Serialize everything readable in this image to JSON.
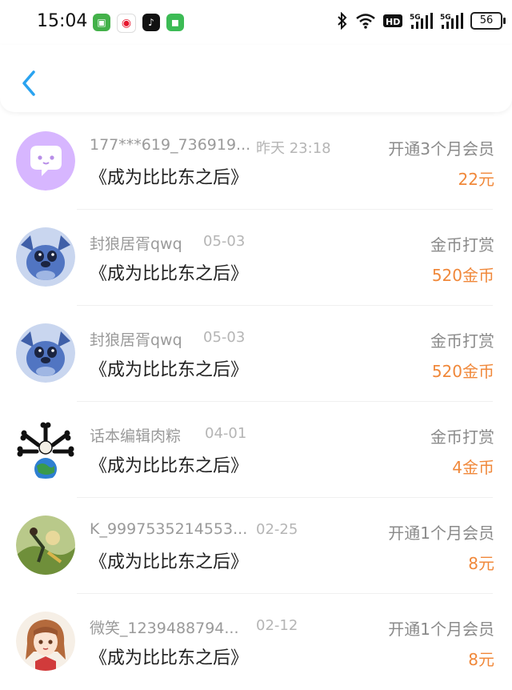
{
  "status_bar": {
    "time": "15:04",
    "battery": "56",
    "icons": [
      "app-green-icon",
      "weibo-icon",
      "tiktok-icon",
      "wechat-icon",
      "bluetooth-icon",
      "wifi-icon",
      "hd-icon",
      "signal-5g-icon",
      "signal-5g-icon-2",
      "battery-icon"
    ]
  },
  "header": {
    "back_icon": "chevron-left-icon",
    "accent": "#2aa3f0"
  },
  "accent_amount_color": "#f0883a",
  "records": [
    {
      "name": "177***619_736919...",
      "date": "昨天 23:18",
      "book": "《成为比比东之后》",
      "type": "开通3个月会员",
      "amount": "22元",
      "avatar": "chat-bubble-avatar"
    },
    {
      "name": "封狼居胥qwq",
      "date": "05-03",
      "book": "《成为比比东之后》",
      "type": "金币打赏",
      "amount": "520金币",
      "avatar": "stitch-avatar"
    },
    {
      "name": "封狼居胥qwq",
      "date": "05-03",
      "book": "《成为比比东之后》",
      "type": "金币打赏",
      "amount": "520金币",
      "avatar": "stitch-avatar"
    },
    {
      "name": "话本编辑肉粽",
      "date": "04-01",
      "book": "《成为比比东之后》",
      "type": "金币打赏",
      "amount": "4金币",
      "avatar": "bone-earth-avatar"
    },
    {
      "name": "K_9997535214553...",
      "date": "02-25",
      "book": "《成为比比东之后》",
      "type": "开通1个月会员",
      "amount": "8元",
      "avatar": "anime-scene-avatar"
    },
    {
      "name": "微笑_1239488794...",
      "date": "02-12",
      "book": "《成为比比东之后》",
      "type": "开通1个月会员",
      "amount": "8元",
      "avatar": "anime-girl-avatar"
    }
  ]
}
